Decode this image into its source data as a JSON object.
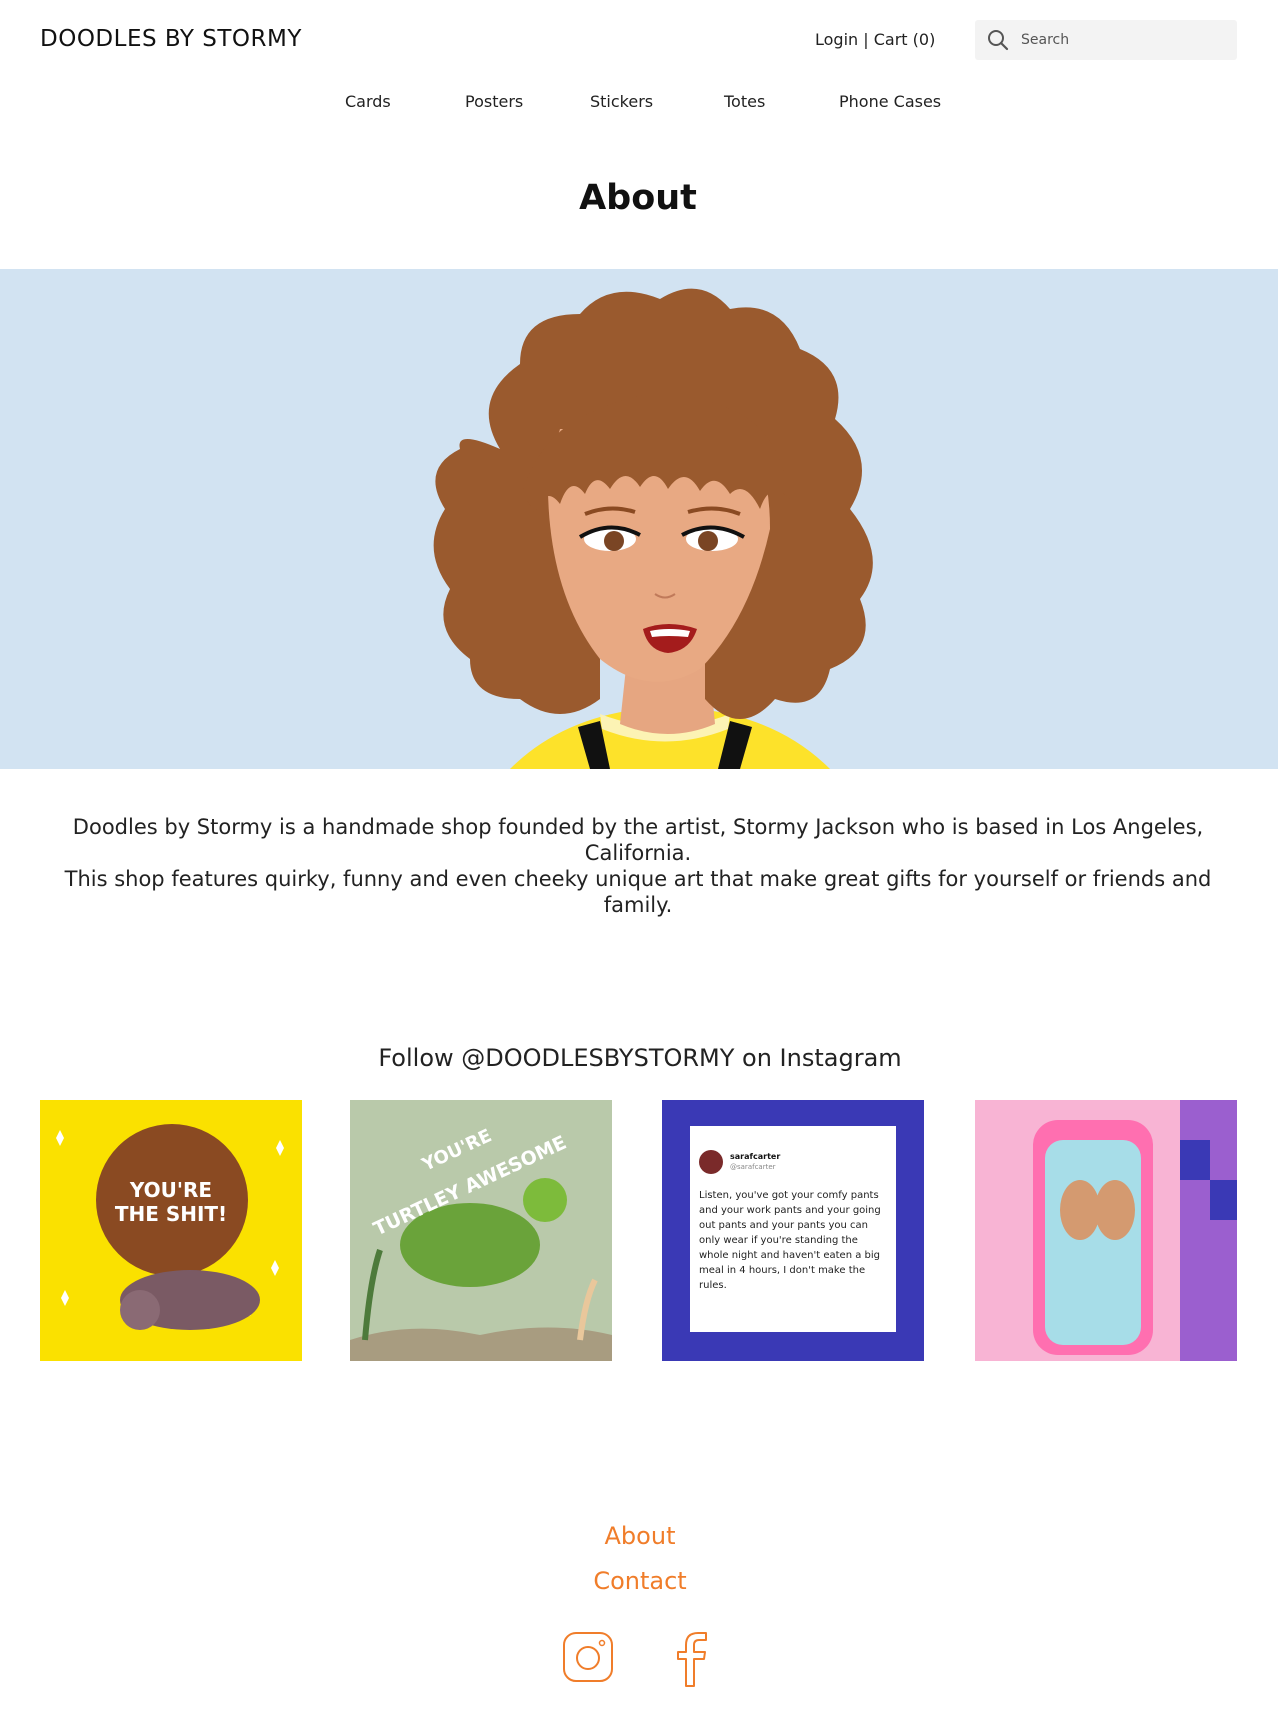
{
  "brand": "DOODLES BY STORMY",
  "account": {
    "login": "Login",
    "separator": " | ",
    "cart": "Cart (0)"
  },
  "search": {
    "placeholder": "Search"
  },
  "nav": [
    "Cards",
    "Posters",
    "Stickers",
    "Totes",
    "Phone Cases"
  ],
  "page_title": "About",
  "intro": {
    "line1": "Doodles by Stormy is a handmade shop founded by the artist, Stormy Jackson who is based in Los Angeles, California.",
    "line2": "This shop features quirky, funny and even cheeky unique art that make great gifts for yourself or friends and family."
  },
  "instagram": {
    "heading": "Follow @DOODLESBYSTORMY on Instagram",
    "posts": [
      {
        "text_line1": "YOU'RE",
        "text_line2": "THE SHIT!"
      },
      {
        "text_line1": "YOU'RE",
        "text_line2": "TURTLEY AWESOME"
      },
      {
        "username": "sarafcarter",
        "handle": "@sarafcarter",
        "tweet": "Listen, you've got your comfy pants and your work pants and your going out pants and your pants you can only wear if you're standing the whole night and haven't eaten a big meal in 4 hours, I don't make the rules."
      },
      {}
    ]
  },
  "footer": {
    "links": [
      "About",
      "Contact"
    ]
  },
  "colors": {
    "accent": "#f07d2a",
    "hero_bg": "#d2e3f2"
  }
}
